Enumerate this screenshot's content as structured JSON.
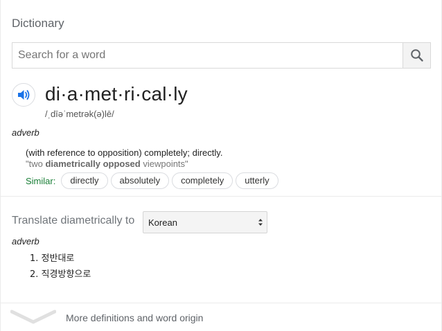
{
  "header": {
    "title": "Dictionary"
  },
  "search": {
    "placeholder": "Search for a word",
    "value": "",
    "icon": "search-icon"
  },
  "entry": {
    "headword": "di·a·met·ri·cal·ly",
    "phonetic": "/ˌdīəˈmetrək(ə)lē/",
    "audio_icon": "speaker-icon",
    "part_of_speech": "adverb",
    "definition": "(with reference to opposition) completely; directly.",
    "example": {
      "open_quote": "\"two ",
      "highlight": "diametrically opposed",
      "rest": " viewpoints\""
    },
    "similar_label": "Similar:",
    "similar": [
      "directly",
      "absolutely",
      "completely",
      "utterly"
    ]
  },
  "translate": {
    "label": "Translate diametrically to",
    "language": "Korean",
    "part_of_speech": "adverb",
    "results": [
      "1. 정반대로",
      "2. 직경방향으로"
    ]
  },
  "footer": {
    "more_label": "More definitions and word origin",
    "icon": "chevron-down-icon"
  },
  "colors": {
    "accent_blue": "#1a73e8",
    "similar_green": "#1a7f37",
    "border": "#d9d9d9"
  }
}
